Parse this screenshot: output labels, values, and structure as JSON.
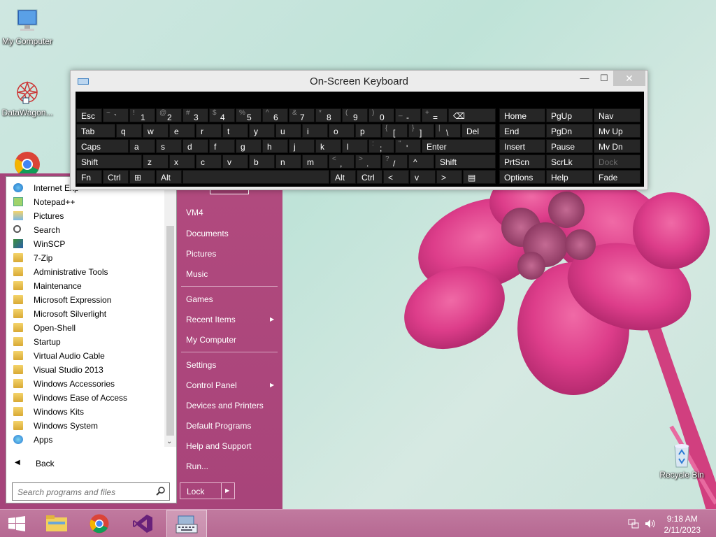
{
  "desktop": {
    "icons": [
      {
        "label": "My Computer",
        "icon": "computer-icon"
      },
      {
        "label": "DataWagon...",
        "icon": "datawagon-icon"
      },
      {
        "label": "Recycle Bin",
        "icon": "recycle-bin-icon"
      }
    ]
  },
  "osk": {
    "title": "On-Screen Keyboard",
    "minimize": "—",
    "maximize": "☐",
    "close": "✕",
    "rows": {
      "r1": [
        {
          "m": "Esc"
        },
        {
          "s": "~",
          "b": "`"
        },
        {
          "s": "!",
          "b": "1"
        },
        {
          "s": "@",
          "b": "2"
        },
        {
          "s": "#",
          "b": "3"
        },
        {
          "s": "$",
          "b": "4"
        },
        {
          "s": "%",
          "b": "5"
        },
        {
          "s": "^",
          "b": "6"
        },
        {
          "s": "&",
          "b": "7"
        },
        {
          "s": "*",
          "b": "8"
        },
        {
          "s": "(",
          "b": "9"
        },
        {
          "s": ")",
          "b": "0"
        },
        {
          "s": "_",
          "b": "-"
        },
        {
          "s": "+",
          "b": "="
        },
        {
          "m": "⌫"
        }
      ],
      "r2": [
        {
          "m": "Tab"
        },
        {
          "m": "q"
        },
        {
          "m": "w"
        },
        {
          "m": "e"
        },
        {
          "m": "r"
        },
        {
          "m": "t"
        },
        {
          "m": "y"
        },
        {
          "m": "u"
        },
        {
          "m": "i"
        },
        {
          "m": "o"
        },
        {
          "m": "p"
        },
        {
          "s": "{",
          "b": "["
        },
        {
          "s": "}",
          "b": "]"
        },
        {
          "s": "|",
          "b": "\\"
        },
        {
          "m": "Del"
        }
      ],
      "r3": [
        {
          "m": "Caps"
        },
        {
          "m": "a"
        },
        {
          "m": "s"
        },
        {
          "m": "d"
        },
        {
          "m": "f"
        },
        {
          "m": "g"
        },
        {
          "m": "h"
        },
        {
          "m": "j"
        },
        {
          "m": "k"
        },
        {
          "m": "l"
        },
        {
          "s": ":",
          "b": ";"
        },
        {
          "s": "\"",
          "b": "'"
        },
        {
          "m": "Enter"
        }
      ],
      "r4": [
        {
          "m": "Shift"
        },
        {
          "m": "z"
        },
        {
          "m": "x"
        },
        {
          "m": "c"
        },
        {
          "m": "v"
        },
        {
          "m": "b"
        },
        {
          "m": "n"
        },
        {
          "m": "m"
        },
        {
          "s": "<",
          "b": ","
        },
        {
          "s": ">",
          "b": "."
        },
        {
          "s": "?",
          "b": "/"
        },
        {
          "m": "^"
        },
        {
          "m": "Shift"
        }
      ],
      "r5": [
        {
          "m": "Fn"
        },
        {
          "m": "Ctrl"
        },
        {
          "m": "⊞"
        },
        {
          "m": "Alt"
        },
        {
          "m": ""
        },
        {
          "m": "Alt"
        },
        {
          "m": "Ctrl"
        },
        {
          "m": "<"
        },
        {
          "m": "v"
        },
        {
          "m": ">"
        },
        {
          "m": "▤"
        }
      ]
    },
    "nav": [
      [
        "Home",
        "PgUp",
        "Nav"
      ],
      [
        "End",
        "PgDn",
        "Mv Up"
      ],
      [
        "Insert",
        "Pause",
        "Mv Dn"
      ],
      [
        "PrtScn",
        "ScrLk",
        "Dock"
      ],
      [
        "Options",
        "Help",
        "Fade"
      ]
    ]
  },
  "start_menu": {
    "programs": [
      {
        "label": "Internet Exp",
        "icon": "ie-icon"
      },
      {
        "label": "Notepad++",
        "icon": "notepadpp-icon"
      },
      {
        "label": "Pictures",
        "icon": "pictures-icon"
      },
      {
        "label": "Search",
        "icon": "search-icon"
      },
      {
        "label": "WinSCP",
        "icon": "winscp-icon"
      },
      {
        "label": "7-Zip",
        "icon": "folder-icon"
      },
      {
        "label": "Administrative Tools",
        "icon": "folder-icon"
      },
      {
        "label": "Maintenance",
        "icon": "folder-icon"
      },
      {
        "label": "Microsoft Expression",
        "icon": "folder-icon"
      },
      {
        "label": "Microsoft Silverlight",
        "icon": "folder-icon"
      },
      {
        "label": "Open-Shell",
        "icon": "folder-icon"
      },
      {
        "label": "Startup",
        "icon": "folder-icon"
      },
      {
        "label": "Virtual Audio Cable",
        "icon": "folder-icon"
      },
      {
        "label": "Visual Studio 2013",
        "icon": "folder-icon"
      },
      {
        "label": "Windows Accessories",
        "icon": "folder-icon"
      },
      {
        "label": "Windows Ease of Access",
        "icon": "folder-icon"
      },
      {
        "label": "Windows Kits",
        "icon": "folder-icon"
      },
      {
        "label": "Windows System",
        "icon": "folder-icon"
      },
      {
        "label": "Apps",
        "icon": "apps-icon"
      }
    ],
    "back": "Back",
    "search_placeholder": "Search programs and files",
    "right": {
      "vm4": "VM4",
      "documents": "Documents",
      "pictures": "Pictures",
      "music": "Music",
      "games": "Games",
      "recent_items": "Recent Items",
      "my_computer": "My Computer",
      "settings": "Settings",
      "control_panel": "Control Panel",
      "devices_printers": "Devices and Printers",
      "default_programs": "Default Programs",
      "help_support": "Help and Support",
      "run": "Run...",
      "lock": "Lock"
    }
  },
  "taskbar": {
    "time": "9:18 AM",
    "date": "2/11/2023",
    "buttons": [
      "start-button",
      "file-explorer",
      "chrome",
      "visual-studio",
      "on-screen-keyboard"
    ]
  }
}
